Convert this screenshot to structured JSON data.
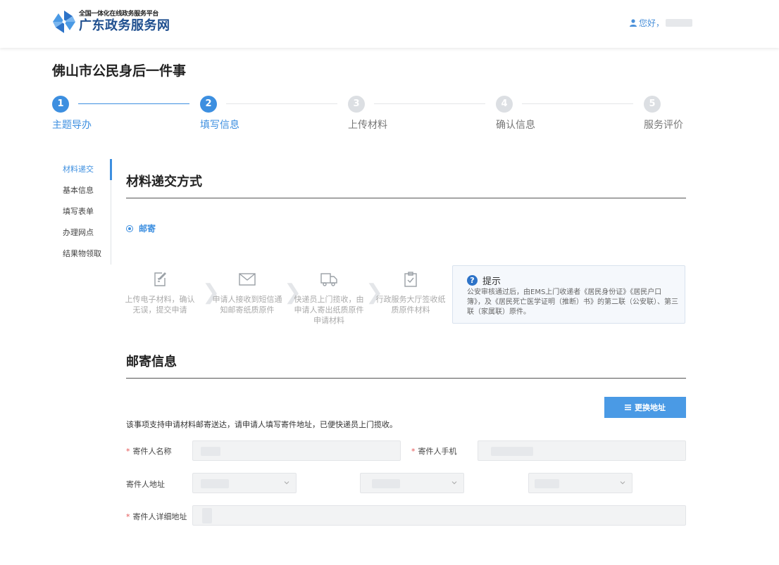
{
  "header": {
    "logo_subtitle": "全国一体化在线政务服务平台",
    "logo_title": "广东政务服务网",
    "greeting": "您好，"
  },
  "page_title": "佛山市公民身后一件事",
  "steps": [
    {
      "num": "1",
      "label": "主题导办",
      "state": "done"
    },
    {
      "num": "2",
      "label": "填写信息",
      "state": "done"
    },
    {
      "num": "3",
      "label": "上传材料",
      "state": "todo"
    },
    {
      "num": "4",
      "label": "确认信息",
      "state": "todo"
    },
    {
      "num": "5",
      "label": "服务评价",
      "state": "todo"
    }
  ],
  "sidenav": [
    "材料递交",
    "基本信息",
    "填写表单",
    "办理网点",
    "结果物领取"
  ],
  "delivery": {
    "title": "材料递交方式",
    "option": "邮寄",
    "flow": [
      {
        "icon": "edit-document-icon",
        "text": "上传电子材料，确认无误，提交申请"
      },
      {
        "icon": "envelope-icon",
        "text": "申请人接收到短信通知邮寄纸质原件"
      },
      {
        "icon": "delivery-truck-icon",
        "text": "快递员上门揽收，由申请人寄出纸质原件申请材料"
      },
      {
        "icon": "clipboard-check-icon",
        "text": "行政服务大厅签收纸质原件材料"
      }
    ],
    "tip_title": "提示",
    "tip_text": "公安审核通过后，由EMS上门收递者《居民身份证》《居民户口簿》，及《居民死亡医学证明（推断）书》的第二联（公安联）、第三联（家属联）原件。"
  },
  "mail": {
    "title": "邮寄信息",
    "change_button": "更换地址",
    "note": "该事项支持申请材料邮寄送达，请申请人填写寄件地址，已便快递员上门揽收。",
    "sender_name_label": "寄件人名称",
    "sender_phone_label": "寄件人手机",
    "sender_address_label": "寄件人地址",
    "sender_detail_label": "寄件人详细地址"
  },
  "colors": {
    "primary": "#3d8fe0",
    "button": "#4a9ae5",
    "required": "#e45656"
  }
}
